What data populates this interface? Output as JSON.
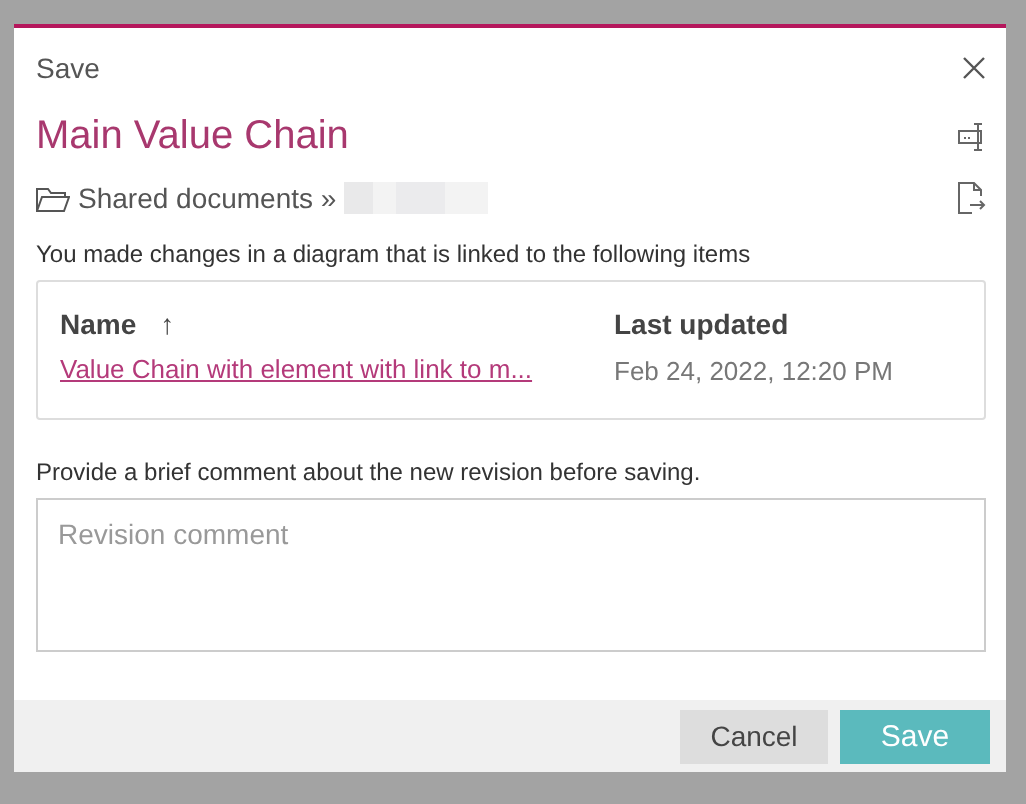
{
  "dialog": {
    "title": "Save",
    "heading": "Main Value Chain",
    "path": "Shared documents »"
  },
  "linked": {
    "message": "You made changes in a diagram that is linked to the following items",
    "columns": [
      {
        "label": "Name",
        "sort_ascending": true,
        "sort_icon": "↑"
      },
      {
        "label": "Last updated"
      }
    ],
    "rows": [
      {
        "name": "Value Chain with element with link to m...",
        "updated": "Feb 24, 2022, 12:20 PM"
      }
    ]
  },
  "comment": {
    "label": "Provide a brief comment about the new revision before saving.",
    "placeholder": "Revision comment"
  },
  "buttons": [
    {
      "label": "Cancel",
      "kind": "secondary"
    },
    {
      "label": "Save",
      "kind": "primary"
    }
  ]
}
